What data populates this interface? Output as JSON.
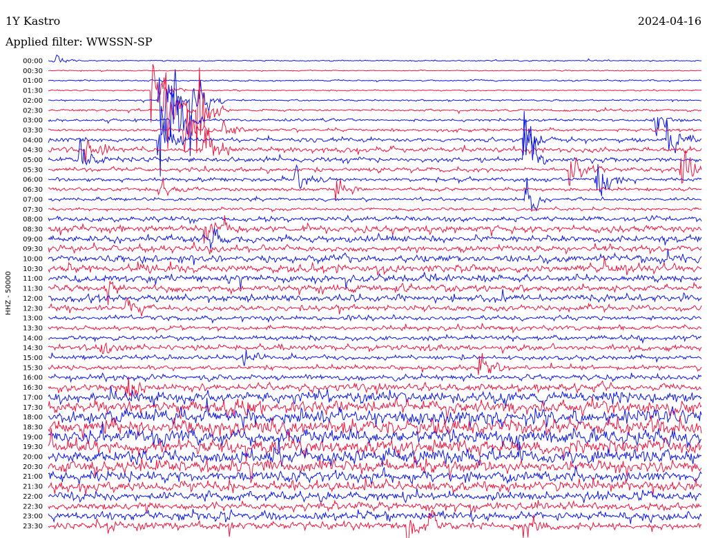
{
  "header": {
    "station": "1Y Kastro",
    "date": "2024-04-16",
    "filter": "Applied filter: WWSSN-SP"
  },
  "colors": {
    "even": "#0a14e6",
    "odd": "#f0143c",
    "background": "#ffffff",
    "text": "#000000"
  },
  "chart_data": {
    "type": "line",
    "ylabel": "HHZ - 50000",
    "tick_labels": [
      "00:00",
      "00:30",
      "01:00",
      "01:30",
      "02:00",
      "02:30",
      "03:00",
      "03:30",
      "04:00",
      "04:30",
      "05:00",
      "05:30",
      "06:00",
      "06:30",
      "07:00",
      "07:30",
      "08:00",
      "08:30",
      "09:00",
      "09:30",
      "10:00",
      "10:30",
      "11:00",
      "11:30",
      "12:00",
      "12:30",
      "13:00",
      "13:30",
      "14:00",
      "14:30",
      "15:00",
      "15:30",
      "16:00",
      "16:30",
      "17:00",
      "17:30",
      "18:00",
      "18:30",
      "19:00",
      "19:30",
      "20:00",
      "20:30",
      "21:00",
      "21:30",
      "22:00",
      "22:30",
      "23:00",
      "23:30"
    ],
    "amplitude_levels": [
      0.5,
      0.4,
      0.6,
      0.5,
      0.7,
      0.9,
      1.0,
      1.1,
      1.6,
      2.0,
      1.8,
      1.7,
      1.5,
      1.4,
      1.3,
      1.2,
      2.0,
      2.8,
      2.6,
      2.5,
      2.9,
      3.2,
      3.0,
      2.8,
      2.7,
      2.3,
      1.9,
      1.8,
      2.0,
      2.2,
      1.8,
      1.9,
      2.3,
      3.0,
      4.5,
      5.5,
      6.0,
      6.2,
      6.0,
      5.8,
      5.5,
      5.2,
      4.5,
      4.2,
      3.6,
      3.2,
      3.3,
      3.0
    ],
    "events": [
      {
        "trace": 0,
        "t": 0.01,
        "amp": 6
      },
      {
        "trace": 3,
        "t": 0.16,
        "amp": 30
      },
      {
        "trace": 4,
        "t": 0.17,
        "amp": 45
      },
      {
        "trace": 4,
        "t": 0.22,
        "amp": 40
      },
      {
        "trace": 5,
        "t": 0.18,
        "amp": 55
      },
      {
        "trace": 5,
        "t": 0.23,
        "amp": 42
      },
      {
        "trace": 6,
        "t": 0.19,
        "amp": 60
      },
      {
        "trace": 6,
        "t": 0.93,
        "amp": 14
      },
      {
        "trace": 7,
        "t": 0.21,
        "amp": 35
      },
      {
        "trace": 7,
        "t": 0.27,
        "amp": 10
      },
      {
        "trace": 8,
        "t": 0.17,
        "amp": 40
      },
      {
        "trace": 8,
        "t": 0.73,
        "amp": 25
      },
      {
        "trace": 8,
        "t": 0.95,
        "amp": 20
      },
      {
        "trace": 9,
        "t": 0.06,
        "amp": 12
      },
      {
        "trace": 9,
        "t": 0.24,
        "amp": 30
      },
      {
        "trace": 10,
        "t": 0.05,
        "amp": 14
      },
      {
        "trace": 10,
        "t": 0.73,
        "amp": 40
      },
      {
        "trace": 11,
        "t": 0.8,
        "amp": 20
      },
      {
        "trace": 11,
        "t": 0.97,
        "amp": 25
      },
      {
        "trace": 12,
        "t": 0.38,
        "amp": 16
      },
      {
        "trace": 12,
        "t": 0.84,
        "amp": 24
      },
      {
        "trace": 13,
        "t": 0.17,
        "amp": 14
      },
      {
        "trace": 13,
        "t": 0.44,
        "amp": 14
      },
      {
        "trace": 14,
        "t": 0.73,
        "amp": 20
      },
      {
        "trace": 17,
        "t": 0.24,
        "amp": 14
      },
      {
        "trace": 18,
        "t": 0.25,
        "amp": 10
      },
      {
        "trace": 23,
        "t": 0.09,
        "amp": 10
      },
      {
        "trace": 25,
        "t": 0.12,
        "amp": 12
      },
      {
        "trace": 29,
        "t": 0.08,
        "amp": 10
      },
      {
        "trace": 30,
        "t": 0.3,
        "amp": 9
      },
      {
        "trace": 31,
        "t": 0.66,
        "amp": 14
      },
      {
        "trace": 33,
        "t": 0.12,
        "amp": 10
      },
      {
        "trace": 35,
        "t": 0.3,
        "amp": 12
      },
      {
        "trace": 47,
        "t": 0.55,
        "amp": 16
      },
      {
        "trace": 47,
        "t": 0.58,
        "amp": 14
      },
      {
        "trace": 47,
        "t": 0.73,
        "amp": 12
      }
    ]
  }
}
